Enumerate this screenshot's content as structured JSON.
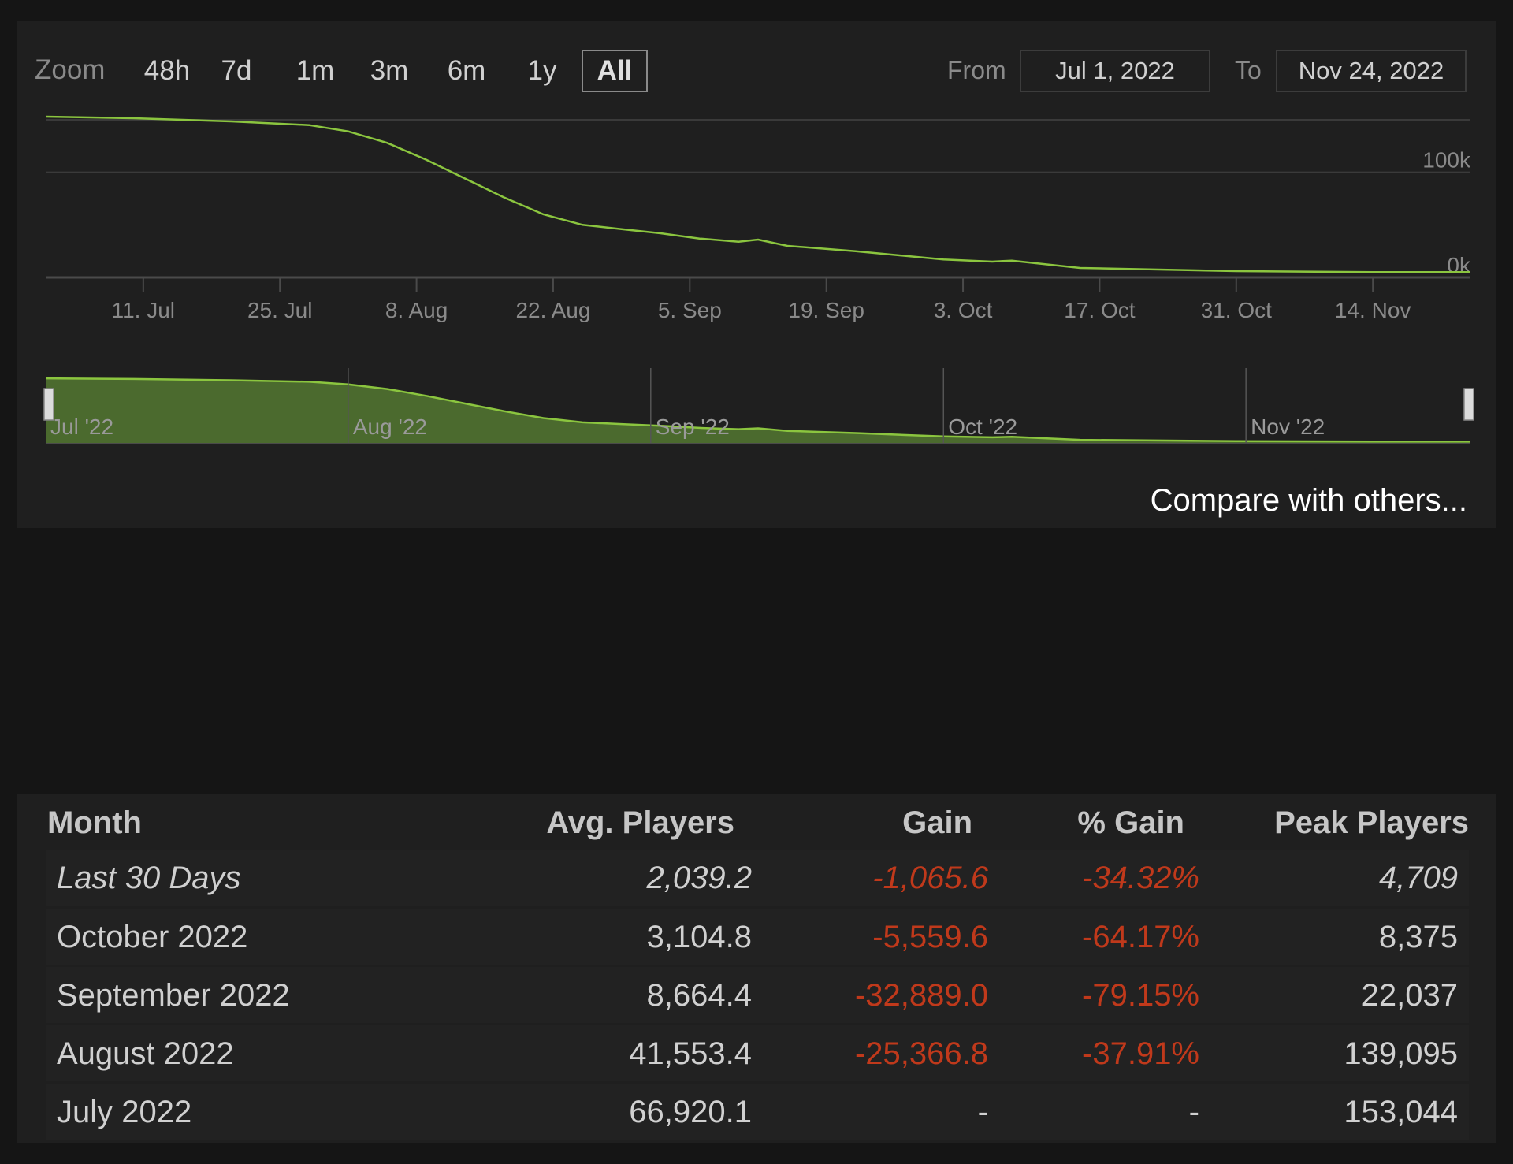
{
  "zoom": {
    "label": "Zoom",
    "options": [
      "48h",
      "7d",
      "1m",
      "3m",
      "6m",
      "1y",
      "All"
    ],
    "active": "All"
  },
  "range": {
    "from_label": "From",
    "from_value": "Jul 1, 2022",
    "to_label": "To",
    "to_value": "Nov 24, 2022"
  },
  "chart_data": {
    "type": "line",
    "title": "",
    "xlabel": "",
    "ylabel": "",
    "ylim": [
      0,
      150000
    ],
    "y_ticks": [
      {
        "value": 0,
        "label": "0k"
      },
      {
        "value": 100000,
        "label": "100k"
      }
    ],
    "x_range": [
      "2022-07-01",
      "2022-11-24"
    ],
    "x_ticks": [
      {
        "date": "2022-07-11",
        "label": "11. Jul"
      },
      {
        "date": "2022-07-25",
        "label": "25. Jul"
      },
      {
        "date": "2022-08-08",
        "label": "8. Aug"
      },
      {
        "date": "2022-08-22",
        "label": "22. Aug"
      },
      {
        "date": "2022-09-05",
        "label": "5. Sep"
      },
      {
        "date": "2022-09-19",
        "label": "19. Sep"
      },
      {
        "date": "2022-10-03",
        "label": "3. Oct"
      },
      {
        "date": "2022-10-17",
        "label": "17. Oct"
      },
      {
        "date": "2022-10-31",
        "label": "31. Oct"
      },
      {
        "date": "2022-11-14",
        "label": "14. Nov"
      }
    ],
    "series": [
      {
        "color": "#8bc53f",
        "points": [
          [
            "2022-07-01",
            153000
          ],
          [
            "2022-07-10",
            151500
          ],
          [
            "2022-07-20",
            148500
          ],
          [
            "2022-07-28",
            145000
          ],
          [
            "2022-08-01",
            139000
          ],
          [
            "2022-08-05",
            128000
          ],
          [
            "2022-08-09",
            112000
          ],
          [
            "2022-08-13",
            94000
          ],
          [
            "2022-08-17",
            76000
          ],
          [
            "2022-08-21",
            60000
          ],
          [
            "2022-08-25",
            50000
          ],
          [
            "2022-08-29",
            46000
          ],
          [
            "2022-09-02",
            42000
          ],
          [
            "2022-09-06",
            37000
          ],
          [
            "2022-09-10",
            34000
          ],
          [
            "2022-09-12",
            36000
          ],
          [
            "2022-09-15",
            30000
          ],
          [
            "2022-09-22",
            25000
          ],
          [
            "2022-10-01",
            17000
          ],
          [
            "2022-10-06",
            15000
          ],
          [
            "2022-10-08",
            16000
          ],
          [
            "2022-10-15",
            9000
          ],
          [
            "2022-10-31",
            6000
          ],
          [
            "2022-11-14",
            5000
          ],
          [
            "2022-11-24",
            5000
          ]
        ]
      }
    ],
    "navigator": {
      "labels": [
        {
          "date": "2022-07-01",
          "label": "Jul '22"
        },
        {
          "date": "2022-08-01",
          "label": "Aug '22"
        },
        {
          "date": "2022-09-01",
          "label": "Sep '22"
        },
        {
          "date": "2022-10-01",
          "label": "Oct '22"
        },
        {
          "date": "2022-11-01",
          "label": "Nov '22"
        }
      ]
    },
    "grid": true,
    "legend": "none"
  },
  "compare_link": "Compare with others...",
  "table": {
    "headers": [
      "Month",
      "Avg. Players",
      "Gain",
      "% Gain",
      "Peak Players"
    ],
    "rows": [
      {
        "month": "Last 30 Days",
        "avg": "2,039.2",
        "gain": "-1,065.6",
        "pct": "-34.32%",
        "peak": "4,709",
        "italic": true
      },
      {
        "month": "October 2022",
        "avg": "3,104.8",
        "gain": "-5,559.6",
        "pct": "-64.17%",
        "peak": "8,375"
      },
      {
        "month": "September 2022",
        "avg": "8,664.4",
        "gain": "-32,889.0",
        "pct": "-79.15%",
        "peak": "22,037"
      },
      {
        "month": "August 2022",
        "avg": "41,553.4",
        "gain": "-25,366.8",
        "pct": "-37.91%",
        "peak": "139,095"
      },
      {
        "month": "July 2022",
        "avg": "66,920.1",
        "gain": "-",
        "pct": "-",
        "peak": "153,044"
      }
    ],
    "negative_color": "#c0391b"
  }
}
